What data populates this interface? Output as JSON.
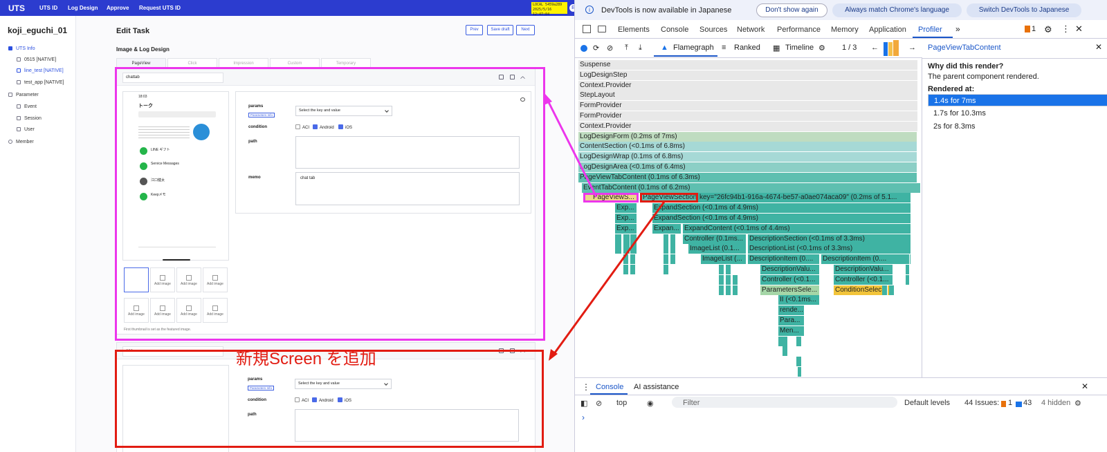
{
  "app": {
    "logo": "UTS",
    "nav": [
      "UTS ID",
      "Log Design",
      "Approve",
      "Request UTS ID"
    ],
    "badge": "LOCAL 5459a289 2025/5/16 12:47:04",
    "avatar": "E",
    "username": "koji_eguchi_01",
    "sidebar": [
      "UTS Info",
      "0515 [NATIVE]",
      "line_test [NATIVE]",
      "test_app [NATIVE]",
      "Parameter",
      "Event",
      "Session",
      "User",
      "Member"
    ],
    "page_title": "Edit Task",
    "buttons": {
      "prev": "Prev",
      "save": "Save draft",
      "next": "Next"
    },
    "section_title": "Image & Log Design",
    "tabs": [
      "PageView",
      "Click",
      "Impression",
      "Custom",
      "Temporary"
    ],
    "screen1": {
      "name": "chattab",
      "params_label": "params",
      "params_info": "Parameters Info",
      "select_placeholder": "Select the key and value",
      "condition_label": "condition",
      "cond": [
        "ACI",
        "Android",
        "iOS"
      ],
      "path_label": "path",
      "memo_label": "memo",
      "memo_value": "chat tab",
      "add_image": "Add image",
      "thumb_note": "First thumbnail is set as the featured image.",
      "phone_time": "18:03",
      "phone_title": "トーク",
      "phone_items": [
        "LINE ギフト",
        "Service Messages",
        "江口健太",
        "Keepメモ"
      ]
    },
    "screen2": {
      "name": "aaa"
    },
    "annotation": "新規Screen を追加"
  },
  "devtools": {
    "banner": {
      "message": "DevTools is now available in Japanese",
      "b1": "Don't show again",
      "b2": "Always match Chrome's language",
      "b3": "Switch DevTools to Japanese"
    },
    "tabs": [
      "Elements",
      "Console",
      "Sources",
      "Network",
      "Performance",
      "Memory",
      "Application",
      "Profiler"
    ],
    "issues_count": "1",
    "profiler": {
      "flamegraph": "Flamegraph",
      "ranked": "Ranked",
      "timeline": "Timeline",
      "commit": "1 / 3",
      "selected": "PageViewTabContent"
    },
    "why": {
      "title": "PageViewTabContent",
      "q": "Why did this render?",
      "a": "The parent component rendered.",
      "rendered_at": "Rendered at:",
      "renders": [
        "1.4s for 7ms",
        "1.7s for 10.3ms",
        "2s for 8.3ms"
      ]
    },
    "flame_rows": [
      "Suspense",
      "LogDesignStep",
      "Context.Provider",
      "StepLayout",
      "FormProvider",
      "FormProvider",
      "Context.Provider",
      "LogDesignForm (0.2ms of 7ms)",
      "ContentSection (<0.1ms of 6.8ms)",
      "LogDesignWrap (0.1ms of 6.8ms)",
      "LogDesignArea (<0.1ms of 6.4ms)",
      "PageViewTabContent (0.1ms of 6.3ms)",
      "EventTabContent (0.1ms of 6.2ms)"
    ],
    "flame_row13": [
      "PageViewS...",
      "PageViewSection",
      "key=\"26fc94b1-916a-4674-be57-a0ae074aca09\" (0.2ms of 5.1..."
    ],
    "flame_row14": [
      "Exp...",
      "ExpandSection (<0.1ms of 4.9ms)"
    ],
    "flame_row15": [
      "Exp...",
      "ExpandSection (<0.1ms of 4.9ms)"
    ],
    "flame_row16": [
      "Exp...",
      "Expan...",
      "ExpandContent (<0.1ms of 4.4ms)"
    ],
    "flame_row17": [
      "Controller (0.1ms...",
      "DescriptionSection (<0.1ms of 3.3ms)"
    ],
    "flame_row18": [
      "ImageList (0.1...",
      "DescriptionList (<0.1ms of 3.3ms)"
    ],
    "flame_row19": [
      "ImageList (...",
      "DescriptionItem (0....",
      "DescriptionItem (0...."
    ],
    "flame_row20": [
      "DescriptionValu...",
      "DescriptionValu..."
    ],
    "flame_row21": [
      "Controller (<0.1...",
      "Controller (<0.1..."
    ],
    "flame_row22": [
      "ParametersSele...",
      "ConditionSelec..."
    ],
    "flame_row23": [
      "II (<0.1ms..."
    ],
    "flame_row24": [
      "rende..."
    ],
    "flame_row25": [
      "Para..."
    ],
    "flame_row26": [
      "Men..."
    ],
    "drawer": {
      "console": "Console",
      "ai": "AI assistance",
      "context": "top",
      "filter": "Filter",
      "levels": "Default levels",
      "issues": "44 Issues:",
      "err": "1",
      "msg": "43",
      "hidden": "4 hidden",
      "prompt": "›"
    }
  }
}
